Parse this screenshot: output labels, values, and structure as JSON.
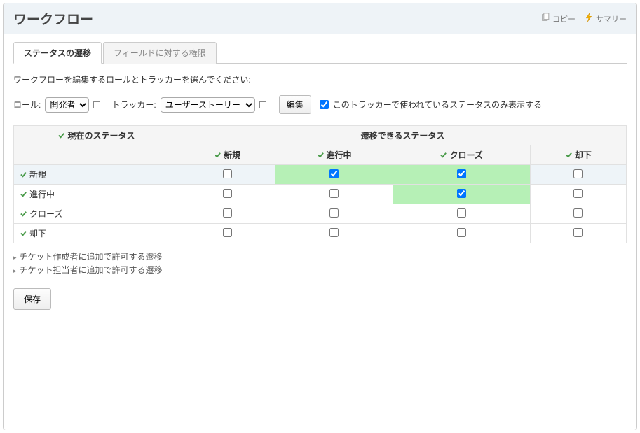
{
  "header": {
    "title": "ワークフロー",
    "copy_label": "コピー",
    "summary_label": "サマリー"
  },
  "tabs": [
    {
      "label": "ステータスの遷移",
      "active": true
    },
    {
      "label": "フィールドに対する権限",
      "active": false
    }
  ],
  "instruction": "ワークフローを編集するロールとトラッカーを選んでください:",
  "filter": {
    "role_label": "ロール:",
    "role_value": "開発者",
    "tracker_label": "トラッカー:",
    "tracker_value": "ユーザーストーリー",
    "edit_label": "編集",
    "only_used_checked": true,
    "only_used_label": "このトラッカーで使われているステータスのみ表示する"
  },
  "table": {
    "current_header": "現在のステータス",
    "allowed_header": "遷移できるステータス",
    "col_statuses": [
      "新規",
      "進行中",
      "クローズ",
      "却下"
    ],
    "rows": [
      {
        "status": "新規",
        "cells": [
          {
            "checked": false,
            "allowed": false
          },
          {
            "checked": true,
            "allowed": true
          },
          {
            "checked": true,
            "allowed": true
          },
          {
            "checked": false,
            "allowed": false
          }
        ],
        "highlight": true
      },
      {
        "status": "進行中",
        "cells": [
          {
            "checked": false,
            "allowed": false
          },
          {
            "checked": false,
            "allowed": false
          },
          {
            "checked": true,
            "allowed": true
          },
          {
            "checked": false,
            "allowed": false
          }
        ],
        "highlight": false
      },
      {
        "status": "クローズ",
        "cells": [
          {
            "checked": false,
            "allowed": false
          },
          {
            "checked": false,
            "allowed": false
          },
          {
            "checked": false,
            "allowed": false
          },
          {
            "checked": false,
            "allowed": false
          }
        ],
        "highlight": false
      },
      {
        "status": "却下",
        "cells": [
          {
            "checked": false,
            "allowed": false
          },
          {
            "checked": false,
            "allowed": false
          },
          {
            "checked": false,
            "allowed": false
          },
          {
            "checked": false,
            "allowed": false
          }
        ],
        "highlight": false
      }
    ]
  },
  "expanders": [
    "チケット作成者に追加で許可する遷移",
    "チケット担当者に追加で許可する遷移"
  ],
  "save_label": "保存"
}
